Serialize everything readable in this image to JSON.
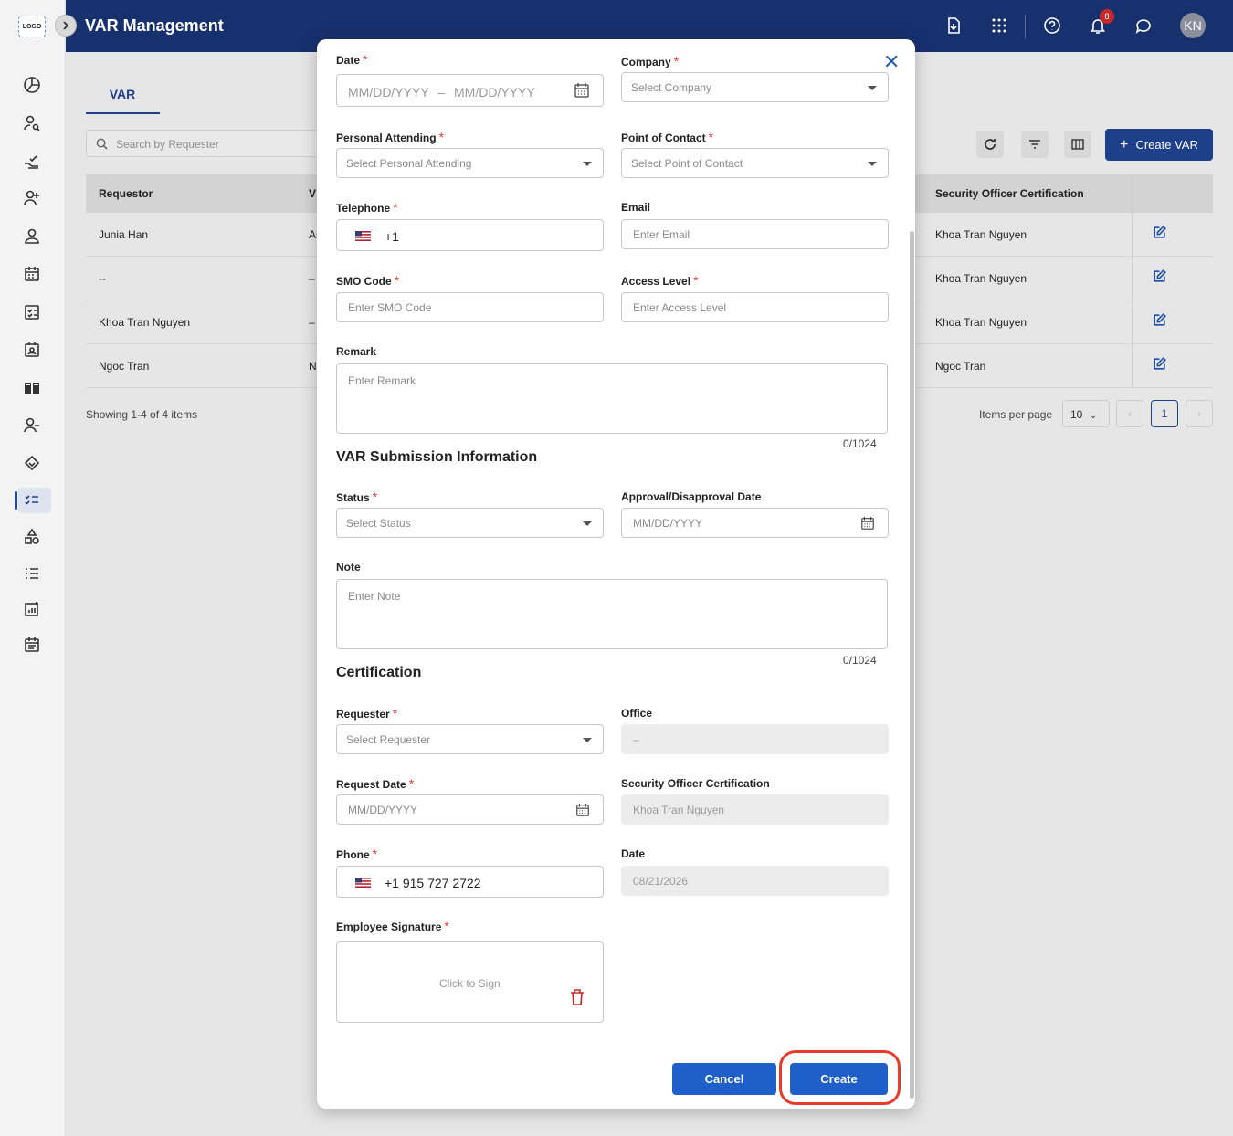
{
  "app": {
    "logo": "LOGO",
    "title": "VAR Management",
    "notifications": "8",
    "avatar": "KN"
  },
  "page": {
    "tab": "VAR",
    "search_placeholder": "Search by Requester",
    "create_button": "Create VAR",
    "columns": [
      "Requestor",
      "V",
      "Security Officer Certification"
    ],
    "rows": [
      {
        "requestor": "Junia Han",
        "v": "Ar",
        "security": "Khoa Tran Nguyen"
      },
      {
        "requestor": "--",
        "v": "–",
        "security": "Khoa Tran Nguyen"
      },
      {
        "requestor": "Khoa Tran Nguyen",
        "v": "–",
        "security": "Khoa Tran Nguyen"
      },
      {
        "requestor": "Ngoc Tran",
        "v": "N",
        "security": "Ngoc Tran"
      }
    ],
    "showing": "Showing 1-4 of 4 items",
    "items_per_page_label": "Items per page",
    "items_per_page": "10",
    "current_page": "1"
  },
  "modal": {
    "date_label": "Date",
    "date_start": "MM/DD/YYYY",
    "date_sep": "–",
    "date_end": "MM/DD/YYYY",
    "company_label": "Company",
    "company_placeholder": "Select Company",
    "personal_label": "Personal Attending",
    "personal_placeholder": "Select Personal Attending",
    "poc_label": "Point of Contact",
    "poc_placeholder": "Select Point of Contact",
    "telephone_label": "Telephone",
    "telephone_value": "+1",
    "email_label": "Email",
    "email_placeholder": "Enter Email",
    "smo_label": "SMO Code",
    "smo_placeholder": "Enter SMO Code",
    "access_label": "Access Level",
    "access_placeholder": "Enter Access Level",
    "remark_label": "Remark",
    "remark_placeholder": "Enter Remark",
    "remark_counter": "0/1024",
    "submission_title": "VAR Submission Information",
    "status_label": "Status",
    "status_placeholder": "Select Status",
    "approval_label": "Approval/Disapproval Date",
    "approval_placeholder": "MM/DD/YYYY",
    "note_label": "Note",
    "note_placeholder": "Enter Note",
    "note_counter": "0/1024",
    "cert_title": "Certification",
    "requester_label": "Requester",
    "requester_placeholder": "Select Requester",
    "office_label": "Office",
    "office_value": "–",
    "request_date_label": "Request Date",
    "request_date_placeholder": "MM/DD/YYYY",
    "soc_label": "Security Officer Certification",
    "soc_value": "Khoa Tran Nguyen",
    "phone_label": "Phone",
    "phone_value": "+1 915 727 2722",
    "cert_date_label": "Date",
    "cert_date_value": "08/21/2026",
    "signature_label": "Employee Signature",
    "signature_placeholder": "Click to Sign",
    "cancel": "Cancel",
    "create": "Create"
  },
  "colors": {
    "primary": "#1f5fc9",
    "topbar": "#17306e",
    "required": "#e53935",
    "highlight": "#e53b2b"
  }
}
